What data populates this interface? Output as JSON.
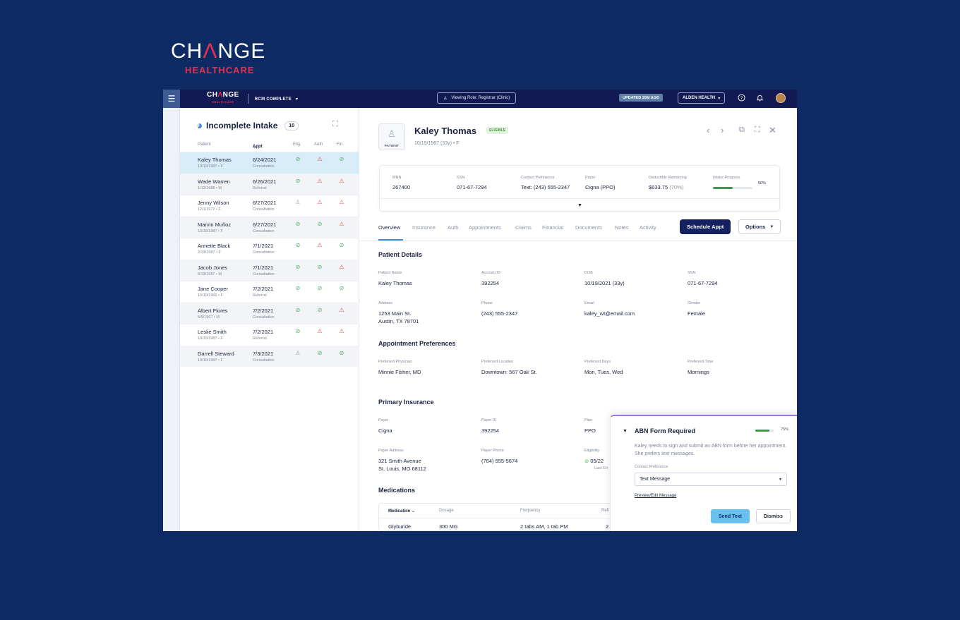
{
  "brand": {
    "logo_top": "CH",
    "logo_tri": "Λ",
    "logo_end": "NGE",
    "logo_bottom": "HEALTHCARE"
  },
  "topbar": {
    "menu_icon": "hamburger-icon",
    "logo_top": "CH",
    "logo_tri": "Λ",
    "logo_end": "NGE",
    "logo_bottom": "HEALTHCARE",
    "product": "RCM COMPLETE",
    "product_caret": "▾",
    "role_label": "Viewing Role: Registrar (Clinic)",
    "updated": "UPDATED 20M AGO",
    "org": "ALDEN HEALTH",
    "org_caret": "▾",
    "help_icon": "?",
    "bell_icon": "🔔"
  },
  "queue": {
    "title": "Incomplete Intake",
    "count": "10",
    "columns": {
      "patient": "Patient",
      "appt": "Appt",
      "elig": "Elig.",
      "auth": "Auth",
      "fin": "Fin."
    },
    "rows": [
      {
        "name": "Kaley Thomas",
        "sub": "10/19/1987 • F",
        "date": "6/24/2021",
        "type": "Consultation",
        "elig": "ok",
        "auth": "warn",
        "fin": "ok"
      },
      {
        "name": "Wade Warren",
        "sub": "1/12/1988 • M",
        "date": "6/26/2021",
        "type": "Referral",
        "elig": "ok",
        "auth": "warn",
        "fin": "warn"
      },
      {
        "name": "Jenny Wilson",
        "sub": "12/1/1972 • F",
        "date": "6/27/2021",
        "type": "Consultation",
        "elig": "pend",
        "auth": "warn",
        "fin": "warn"
      },
      {
        "name": "Marvin Muñoz",
        "sub": "10/19/1987 • F",
        "date": "6/27/2021",
        "type": "Consultation",
        "elig": "ok",
        "auth": "ok",
        "fin": "warn"
      },
      {
        "name": "Annette Black",
        "sub": "2/19/1987 • F",
        "date": "7/1/2021",
        "type": "Consultation",
        "elig": "ok",
        "auth": "warn",
        "fin": "ok"
      },
      {
        "name": "Jacob Jones",
        "sub": "8/19/1987 • M",
        "date": "7/1/2021",
        "type": "Consultation",
        "elig": "ok",
        "auth": "ok",
        "fin": "warn"
      },
      {
        "name": "Jane Cooper",
        "sub": "10/19/1965 • F",
        "date": "7/2/2021",
        "type": "Referral",
        "elig": "ok",
        "auth": "ok",
        "fin": "ok"
      },
      {
        "name": "Albert Flores",
        "sub": "5/5/1967 • M",
        "date": "7/2/2021",
        "type": "Consultation",
        "elig": "ok",
        "auth": "ok",
        "fin": "warn"
      },
      {
        "name": "Leslie Smith",
        "sub": "10/19/1987 • F",
        "date": "7/2/2021",
        "type": "Referral",
        "elig": "ok",
        "auth": "warn",
        "fin": "warn"
      },
      {
        "name": "Darrell Steward",
        "sub": "10/19/1987 • F",
        "date": "7/3/2021",
        "type": "Consultation",
        "elig": "pend",
        "auth": "ok",
        "fin": "ok"
      }
    ]
  },
  "status_icons": {
    "ok": "⊘",
    "warn": "⚠",
    "pend": "♙"
  },
  "patient": {
    "avatar_label": "PATIENT",
    "name": "Kaley Thomas",
    "badge": "ELIGIBLE",
    "sub": "10/19/1987 (33y) • F"
  },
  "summary": {
    "mrn_k": "MRN",
    "mrn_v": "267400",
    "ssn_k": "SSN",
    "ssn_v": "071-67-7294",
    "contact_k": "Contact Preference",
    "contact_v": "Text: (243) 555-2347",
    "payer_k": "Payer",
    "payer_v": "Cigna (PPO)",
    "deductible_k": "Deductible Remaining",
    "deductible_v": "$633.75",
    "deductible_pct": "(70%)",
    "progress_k": "Intake Progress",
    "progress_pct": "50%",
    "progress_value": 0.5
  },
  "tabs": [
    "Overview",
    "Insurance",
    "Auth",
    "Appointments",
    "Claims",
    "Financial",
    "Documents",
    "Notes",
    "Activity"
  ],
  "actions": {
    "schedule": "Schedule Appt",
    "options": "Options"
  },
  "patient_details": {
    "title": "Patient Details",
    "name_k": "Patient Name",
    "name_v": "Kaley Thomas",
    "account_k": "Account ID",
    "account_v": "392254",
    "dob_k": "DOB",
    "dob_v": "10/19/2021 (33y)",
    "ssn_k": "SSN",
    "ssn_v": "071-67-7294",
    "address_k": "Address",
    "address_v1": "1253 Main St.",
    "address_v2": "Austin, TX 78701",
    "phone_k": "Phone",
    "phone_v": "(243) 555-2347",
    "email_k": "Email",
    "email_v": "kaley_wt@email.com",
    "gender_k": "Gender",
    "gender_v": "Female"
  },
  "appointment_prefs": {
    "title": "Appointment Preferences",
    "physician_k": "Preferred Physician",
    "physician_v": "Minnie Fisher, MD",
    "location_k": "Preferred Location",
    "location_v": "Downtown: 567 Oak St.",
    "days_k": "Preferred Days",
    "days_v": "Mon, Tues, Wed",
    "time_k": "Preferred Time",
    "time_v": "Mornings"
  },
  "primary_insurance": {
    "title": "Primary Insurance",
    "payer_k": "Payer",
    "payer_v": "Cigna",
    "payer_id_k": "Payer ID",
    "payer_id_v": "392254",
    "plan_k": "Plan",
    "plan_v": "PPO",
    "payer_addr_k": "Payer Address",
    "payer_addr_v1": "321 Smith Avenue",
    "payer_addr_v2": "St. Louis, MO 68112",
    "payer_phone_k": "Payer Phone",
    "payer_phone_v": "(764) 555-5674",
    "elig_k": "Eligibility",
    "elig_v": "05/22",
    "elig_v2": "Last Ch"
  },
  "medications": {
    "title": "Medications",
    "headers": {
      "medication": "Medication",
      "dosage": "Dosage",
      "frequency": "Frequency",
      "refill": "Refi"
    },
    "rows": [
      {
        "medication": "Glyburide",
        "dosage": "300 MG",
        "frequency": "2 tabs AM, 1 tab PM",
        "refill": "2"
      }
    ]
  },
  "abn_popup": {
    "title": "ABN Form Required",
    "progress_pct": "75%",
    "progress_value": 0.75,
    "message": "Kaley needs to sign and submit an ABN form before her appointment. She prefers text messages.",
    "contact_label": "Contact Preference",
    "contact_value": "Text Message",
    "link": "Preview/Edit Message",
    "send": "Send Text",
    "dismiss": "Dismiss"
  }
}
